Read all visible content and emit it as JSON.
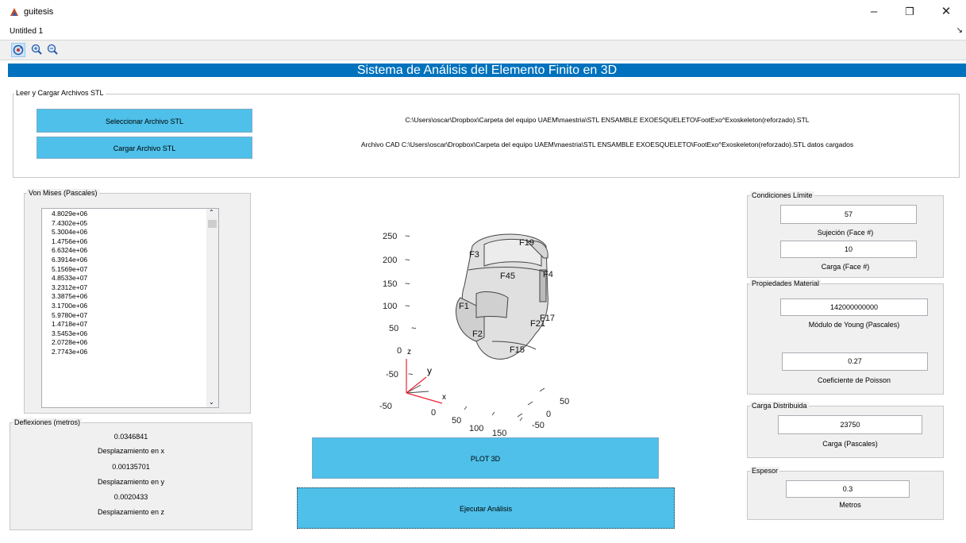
{
  "window": {
    "title": "guitesis",
    "minimize": "–",
    "restore": "❐",
    "close": "✕"
  },
  "menu": {
    "item": "Untitled 1",
    "arrow": "↘"
  },
  "toolbar": {
    "icons": [
      "rotate-3d-icon",
      "zoom-in-icon",
      "zoom-out-icon"
    ]
  },
  "banner": {
    "title": "Sistema de Análisis del Elemento Finito en 3D"
  },
  "file_panel": {
    "title": "Leer y Cargar Archivos STL",
    "select_button": "Seleccionar Archivo STL",
    "load_button": "Cargar Archivo STL",
    "path_text": "C:\\Users\\oscar\\Dropbox\\Carpeta del equipo UAEM\\maestria\\STL ENSAMBLE EXOESQUELETO\\FootExo^Exoskeleton(reforzado).STL",
    "loaded_text": "Archivo CAD C:\\Users\\oscar\\Dropbox\\Carpeta del equipo UAEM\\maestria\\STL ENSAMBLE EXOESQUELETO\\FootExo^Exoskeleton(reforzado).STL datos cargados"
  },
  "von_mises": {
    "title": "Von Mises (Pascales)",
    "values": [
      "4.8029e+06",
      "7.4302e+05",
      "5.3004e+06",
      "1.4756e+06",
      "6.6324e+06",
      "6.3914e+06",
      "5.1569e+07",
      "4.8533e+07",
      "3.2312e+07",
      "3.3875e+06",
      "3.1700e+06",
      "5.9780e+07",
      "1.4718e+07",
      "3.5453e+06",
      "2.0728e+06",
      "2.7743e+06"
    ]
  },
  "deflexiones": {
    "title": "Deflexiones (metros)",
    "x_value": "0.0346841",
    "x_label": "Desplazamiento en x",
    "y_value": "0.00135701",
    "y_label": "Desplazamiento en y",
    "z_value": "0.0020433",
    "z_label": "Desplazamiento en z"
  },
  "plot3d": {
    "z_ticks": [
      "250",
      "200",
      "150",
      "100",
      "50",
      "0",
      "-50"
    ],
    "x_ticks": [
      "-50",
      "0",
      "50",
      "100",
      "150"
    ],
    "y_ticks": [
      "50",
      "0",
      "-50"
    ],
    "axis_labels": {
      "z": "z",
      "y": "y",
      "x": "x"
    },
    "face_labels": [
      "F19",
      "F3",
      "F45",
      "F4",
      "F1",
      "F17",
      "F21",
      "F15",
      "F2"
    ]
  },
  "actions": {
    "plot_button": "PLOT 3D",
    "run_button": "Ejecutar Análisis"
  },
  "condiciones": {
    "title": "Condiciones Límite",
    "sujecion_value": "57",
    "sujecion_label": "Sujeción (Face #)",
    "carga_value": "10",
    "carga_label": "Carga (Face #)"
  },
  "material": {
    "title": "Propiedades Material",
    "young_value": "142000000000",
    "young_label": "Módulo de Young (Pascales)",
    "poisson_value": "0.27",
    "poisson_label": "Coeficiente de Poisson"
  },
  "carga_dist": {
    "title": "Carga Distribuida",
    "value": "23750",
    "label": "Carga (Pascales)"
  },
  "espesor": {
    "title": "Espesor",
    "value": "0.3",
    "label": "Metros"
  },
  "colors": {
    "banner": "#0072bd",
    "button": "#4ec0ea",
    "panel_bg": "#f0f0f0"
  }
}
